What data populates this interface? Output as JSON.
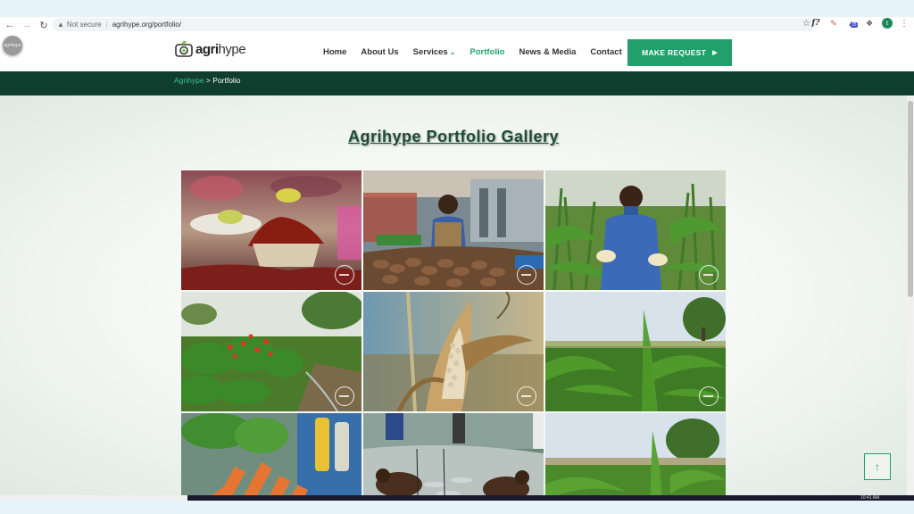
{
  "browser": {
    "security_label": "Not secure",
    "url": "agrihype.org/portfolio/",
    "profile_initial": "t",
    "extension_badge": "15"
  },
  "site": {
    "corner_badge_text": "agrihype",
    "logo_main": "agri",
    "logo_accent": "hype",
    "nav": [
      {
        "label": "Home"
      },
      {
        "label": "About Us"
      },
      {
        "label": "Services"
      },
      {
        "label": "Portfolio"
      },
      {
        "label": "News & Media"
      },
      {
        "label": "Contact"
      }
    ],
    "cta_label": "MAKE REQUEST",
    "breadcrumb": {
      "home": "Agrihype",
      "separator": " > ",
      "current": "Portfolio"
    }
  },
  "page": {
    "title": "Agrihype Portfolio Gallery",
    "gallery": [
      {
        "name": "dried-chili-market-photo"
      },
      {
        "name": "market-vendor-produce-photo"
      },
      {
        "name": "farmer-in-maize-field-photo"
      },
      {
        "name": "pepper-plants-field-photo"
      },
      {
        "name": "dry-maize-cob-photo"
      },
      {
        "name": "young-maize-field-photo"
      },
      {
        "name": "carrots-closeup-photo"
      },
      {
        "name": "fishermen-harvest-photo"
      },
      {
        "name": "maize-field-tree-photo"
      }
    ]
  },
  "colors": {
    "brand_green": "#22a06b",
    "band_dark": "#0f3d2e",
    "title_green": "#1d4b39"
  },
  "icons": [
    "back-arrow-icon",
    "forward-arrow-icon",
    "reload-icon",
    "warning-icon",
    "star-icon",
    "extension-icon",
    "kebab-menu-icon",
    "play-triangle-icon",
    "arrow-up-icon"
  ],
  "taskbar": {
    "clock": "10:41 AM"
  }
}
